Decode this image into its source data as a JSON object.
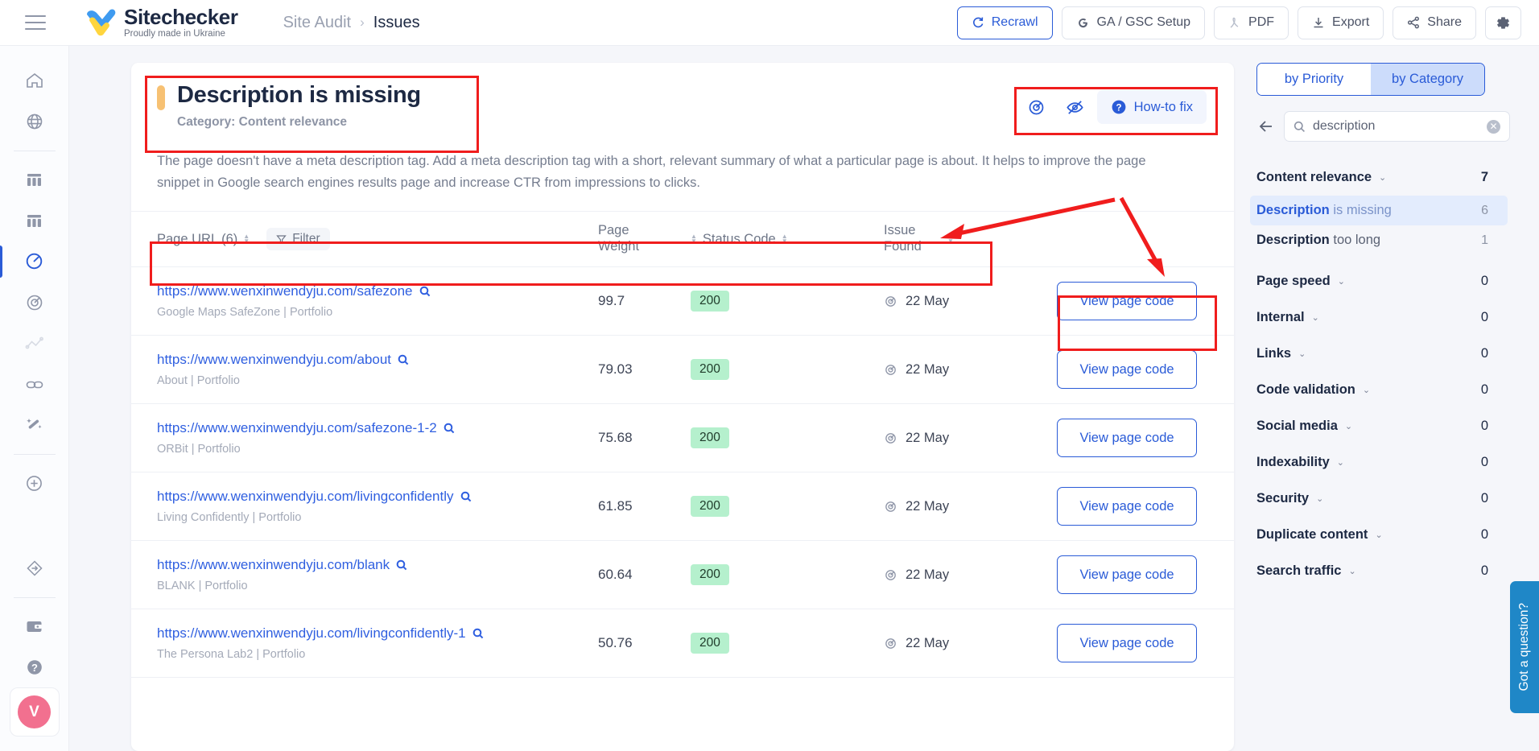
{
  "topbar": {
    "menu_icon": "hamburger-icon",
    "logo_title": "Sitechecker",
    "logo_sub": "Proudly made in Ukraine",
    "breadcrumb_root": "Site Audit",
    "breadcrumb_sep": "›",
    "breadcrumb_current": "Issues",
    "actions": [
      {
        "label": "Recrawl",
        "icon": "refresh-icon",
        "primary": true
      },
      {
        "label": "GA / GSC Setup",
        "icon": "google-icon",
        "primary": false
      },
      {
        "label": "PDF",
        "icon": "pdf-icon",
        "primary": false
      },
      {
        "label": "Export",
        "icon": "download-icon",
        "primary": false
      },
      {
        "label": "Share",
        "icon": "share-icon",
        "primary": false
      }
    ],
    "settings_icon": "gear-icon"
  },
  "rail": {
    "items": [
      {
        "icon": "home-icon",
        "active": false
      },
      {
        "icon": "globe-icon",
        "active": false
      },
      {
        "icon": "table-columns-icon",
        "active": false
      },
      {
        "icon": "table-columns-icon-2",
        "active": false
      },
      {
        "icon": "speedometer-icon",
        "active": true
      },
      {
        "icon": "target-icon",
        "active": false
      },
      {
        "icon": "line-chart-icon",
        "active": false
      },
      {
        "icon": "link-icon",
        "active": false
      },
      {
        "icon": "magic-wand-icon",
        "active": false
      },
      {
        "icon": "plus-circle-icon",
        "active": false
      },
      {
        "icon": "diamond-arrow-icon",
        "active": false
      },
      {
        "icon": "wallet-icon",
        "active": false
      },
      {
        "icon": "question-circle-icon",
        "active": false
      }
    ],
    "avatar_initial": "V"
  },
  "issue": {
    "priority_color": "#f7c173",
    "title": "Description is missing",
    "category": "Category: Content relevance",
    "description": "The page doesn't have a meta description tag. Add a meta description tag with a short, relevant summary of what a particular page is about. It helps to improve the page snippet in Google search engines results page and increase CTR from impressions to clicks.",
    "head_actions": {
      "target_icon": "target-icon",
      "hide_icon": "eye-slash-icon",
      "howto_label": "How-to fix",
      "howto_icon": "question-mark-icon"
    }
  },
  "table": {
    "columns": {
      "url": "Page URL (6)",
      "filter": "Filter",
      "page_weight": "Page Weight",
      "status_code": "Status Code",
      "issue_found": "Issue Found",
      "action": ""
    },
    "action_label": "View page code",
    "rows": [
      {
        "url": "https://www.wenxinwendyju.com/safezone",
        "title": "Google Maps SafeZone | Portfolio",
        "page_weight": "99.7",
        "status_code": "200",
        "issue_found": "22 May"
      },
      {
        "url": "https://www.wenxinwendyju.com/about",
        "title": "About | Portfolio",
        "page_weight": "79.03",
        "status_code": "200",
        "issue_found": "22 May"
      },
      {
        "url": "https://www.wenxinwendyju.com/safezone-1-2",
        "title": "ORBit | Portfolio",
        "page_weight": "75.68",
        "status_code": "200",
        "issue_found": "22 May"
      },
      {
        "url": "https://www.wenxinwendyju.com/livingconfidently",
        "title": "Living Confidently | Portfolio",
        "page_weight": "61.85",
        "status_code": "200",
        "issue_found": "22 May"
      },
      {
        "url": "https://www.wenxinwendyju.com/blank",
        "title": "BLANK | Portfolio",
        "page_weight": "60.64",
        "status_code": "200",
        "issue_found": "22 May"
      },
      {
        "url": "https://www.wenxinwendyju.com/livingconfidently-1",
        "title": "The Persona Lab2 | Portfolio",
        "page_weight": "50.76",
        "status_code": "200",
        "issue_found": "22 May"
      }
    ]
  },
  "rightpanel": {
    "tab_priority": "by Priority",
    "tab_category": "by Category",
    "active_tab": "by Category",
    "search_value": "description",
    "search_placeholder": "Search",
    "groups": [
      {
        "name": "Content relevance",
        "count": "7",
        "items": [
          {
            "bold": "Description",
            "rest": " is missing",
            "count": "6",
            "selected": true
          },
          {
            "bold": "Description",
            "rest": " too long",
            "count": "1",
            "selected": false
          }
        ]
      },
      {
        "name": "Page speed",
        "count": "0",
        "items": []
      },
      {
        "name": "Internal",
        "count": "0",
        "items": []
      },
      {
        "name": "Links",
        "count": "0",
        "items": []
      },
      {
        "name": "Code validation",
        "count": "0",
        "items": []
      },
      {
        "name": "Social media",
        "count": "0",
        "items": []
      },
      {
        "name": "Indexability",
        "count": "0",
        "items": []
      },
      {
        "name": "Security",
        "count": "0",
        "items": []
      },
      {
        "name": "Duplicate content",
        "count": "0",
        "items": []
      },
      {
        "name": "Search traffic",
        "count": "0",
        "items": []
      }
    ]
  },
  "help_widget": {
    "label": "Got a question?"
  },
  "annotation_color": "#f01d1d"
}
